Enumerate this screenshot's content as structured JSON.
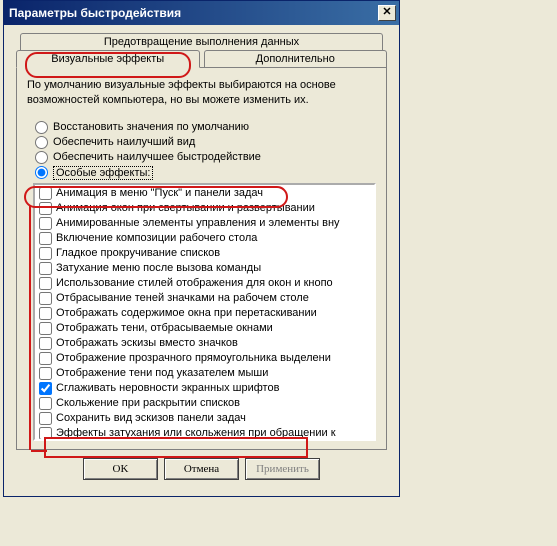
{
  "title": "Параметры быстродействия",
  "close_glyph": "✕",
  "tabs": {
    "dep": "Предотвращение выполнения данных",
    "visual": "Визуальные эффекты",
    "advanced": "Дополнительно"
  },
  "description": "По умолчанию визуальные эффекты выбираются на основе возможностей компьютера, но вы можете изменить их.",
  "radios": {
    "r0": "Восстановить значения по умолчанию",
    "r1": "Обеспечить наилучший вид",
    "r2": "Обеспечить наилучшее быстродействие",
    "r3": "Особые эффекты:"
  },
  "selected_radio": "r3",
  "effects": [
    {
      "label": "Анимация в меню \"Пуск\" и панели задач",
      "checked": false
    },
    {
      "label": "Анимация окон при свертывании и развертывании",
      "checked": false
    },
    {
      "label": "Анимированные элементы управления и элементы вну",
      "checked": false
    },
    {
      "label": "Включение композиции рабочего стола",
      "checked": false
    },
    {
      "label": "Гладкое прокручивание списков",
      "checked": false
    },
    {
      "label": "Затухание меню после вызова команды",
      "checked": false
    },
    {
      "label": "Использование стилей отображения для окон и кнопо",
      "checked": false
    },
    {
      "label": "Отбрасывание теней значками на рабочем столе",
      "checked": false
    },
    {
      "label": "Отображать содержимое окна при перетаскивании",
      "checked": false
    },
    {
      "label": "Отображать тени, отбрасываемые окнами",
      "checked": false
    },
    {
      "label": "Отображать эскизы вместо значков",
      "checked": false
    },
    {
      "label": "Отображение прозрачного прямоугольника выделени",
      "checked": false
    },
    {
      "label": "Отображение тени под указателем мыши",
      "checked": false
    },
    {
      "label": "Сглаживать неровности экранных шрифтов",
      "checked": true
    },
    {
      "label": "Скольжение при раскрытии списков",
      "checked": false
    },
    {
      "label": "Сохранить вид эскизов панели задач",
      "checked": false
    },
    {
      "label": "Эффекты затухания или скольжения при обращении к",
      "checked": false
    }
  ],
  "buttons": {
    "ok": "OK",
    "cancel": "Отмена",
    "apply": "Применить"
  }
}
